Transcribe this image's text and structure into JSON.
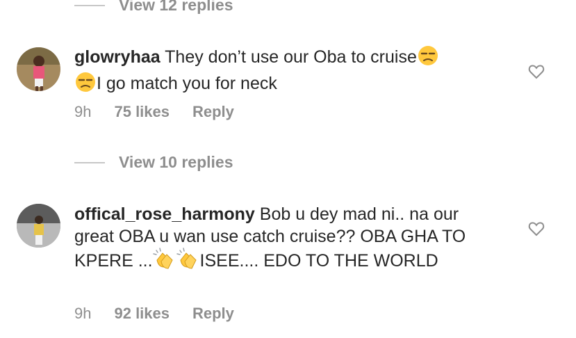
{
  "top_replies": {
    "label": "View 12 replies"
  },
  "comments": [
    {
      "username": "glowryhaa",
      "text_1": "They don’t use our Oba to cruise",
      "text_2": "I go match you for neck",
      "time": "9h",
      "likes": "75 likes",
      "reply": "Reply",
      "replies_label": "View 10 replies",
      "emoji": "unamused-face-emoji"
    },
    {
      "username": "offical_rose_harmony",
      "text_1": "Bob u dey mad ni.. na our great OBA  u wan use catch cruise?? OBA GHA TO KPERE ...",
      "text_2": "ISEE.... EDO TO THE WORLD",
      "time": "9h",
      "likes": "92 likes",
      "reply": "Reply",
      "emoji": "clapping-hands-emoji"
    }
  ],
  "icons": {
    "like": "heart-outline-icon"
  },
  "colors": {
    "text": "#262626",
    "muted": "#8e8e8e",
    "divider": "#c7c7c7"
  }
}
